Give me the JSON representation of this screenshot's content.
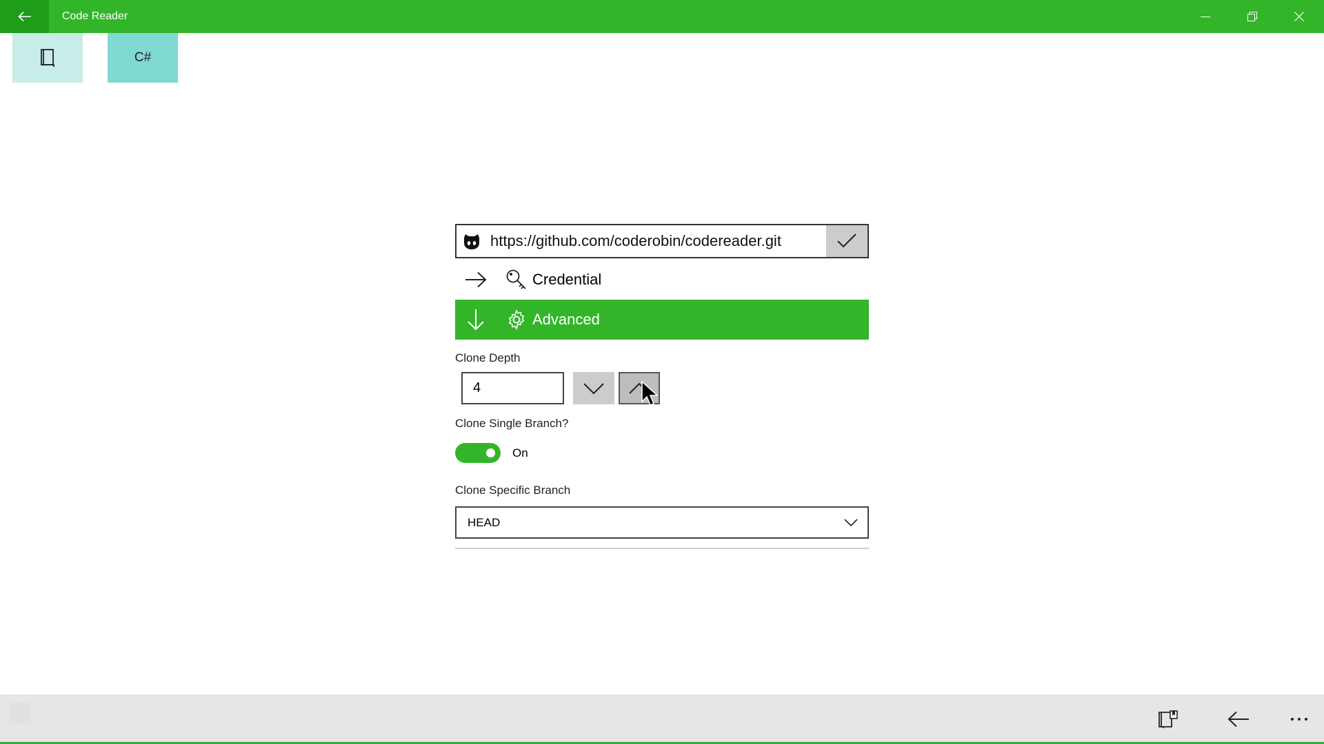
{
  "window": {
    "title": "Code Reader"
  },
  "tiles": [
    {
      "name": "book",
      "label": ""
    },
    {
      "name": "csharp",
      "label": "C#"
    }
  ],
  "repository": {
    "url": "https://github.com/coderobin/codereader.git"
  },
  "sections": {
    "credential": {
      "label": "Credential",
      "expanded": false
    },
    "advanced": {
      "label": "Advanced",
      "expanded": true
    }
  },
  "clone_depth": {
    "label": "Clone Depth",
    "value": "4"
  },
  "single_branch": {
    "label": "Clone Single Branch?",
    "state": "On"
  },
  "specific_branch": {
    "label": "Clone Specific Branch",
    "value": "HEAD"
  },
  "colors": {
    "accent": "#33b52a",
    "accent_dark": "#1e9c1a",
    "tile1": "#c8ece8",
    "tile2": "#7fdad4"
  }
}
